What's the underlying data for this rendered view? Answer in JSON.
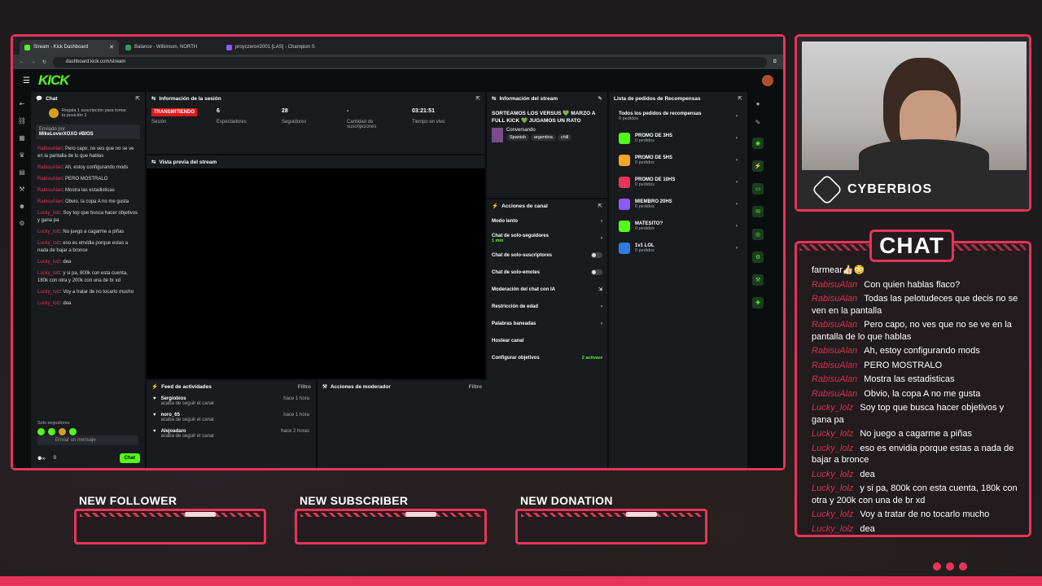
{
  "browser": {
    "tabs": [
      "Stream - Kick Dashboard",
      "Balance - Wilkinson, NORTH",
      "proyczero#2001 [LAS] - Champion S"
    ],
    "url": "dashboard.kick.com/stream"
  },
  "kick": {
    "logo": "KICK"
  },
  "dashboard": {
    "chat_panel": {
      "title": "Chat",
      "gift_text": "Regala 1 suscripción para tomar la posición 1",
      "pinned_label": "Enviado por",
      "pinned_text": "MikeLoverXOXO #BIOS",
      "messages": [
        {
          "user": "RabisuAlan",
          "text": "Pero capo, no ves que no se ve en la pantalla de lo que hablas"
        },
        {
          "user": "RabisuAlan",
          "text": "Ah, estoy configurando mods"
        },
        {
          "user": "RabisuAlan",
          "text": "PERO MOSTRALO"
        },
        {
          "user": "RabisuAlan",
          "text": "Mostra las estadisticas"
        },
        {
          "user": "RabisuAlan",
          "text": "Obvio, la copa A no me gusta"
        },
        {
          "user": "Lucky_lolz",
          "text": "Soy top que busca hacer objetivos y gana pa"
        },
        {
          "user": "Lucky_lolz",
          "text": "No juego a cagarme a piñas"
        },
        {
          "user": "Lucky_lolz",
          "text": "eso es envidia porque estas a nada de bajar a bronce"
        },
        {
          "user": "Lucky_lolz",
          "text": "dea"
        },
        {
          "user": "Lucky_lolz",
          "text": "y si pa, 800k con esta cuenta, 180k con otra y 200k con una de br xd"
        },
        {
          "user": "Lucky_lolz",
          "text": "Voy a tratar de no tocarlo mucho"
        },
        {
          "user": "Lucky_lolz",
          "text": "dea"
        }
      ],
      "followers_only": "Solo seguidores",
      "input_placeholder": "Enviar un mensaje",
      "count": "0",
      "send_label": "Chat"
    },
    "session": {
      "title": "Información de la sesión",
      "status": "TRANSMITIENDO",
      "status_label": "Sesión",
      "viewers": "6",
      "viewers_label": "Espectadores",
      "followers": "28",
      "followers_label": "Seguidores",
      "subs": "-",
      "subs_label": "Cantidad de suscripciones",
      "time": "03:21:51",
      "time_label": "Tiempo en vivo"
    },
    "preview_title": "Vista previa del stream",
    "feed": {
      "title": "Feed de actividades",
      "filter": "Filtro",
      "items": [
        {
          "name": "Sergiobios",
          "sub": "acaba de seguir el canal",
          "time": "hace 1 hora"
        },
        {
          "name": "noro_65",
          "sub": "acaba de seguir el canal",
          "time": "hace 1 hora"
        },
        {
          "name": "Alejoadaro",
          "sub": "acaba de seguir el canal",
          "time": "hace 2 horas"
        }
      ]
    },
    "mod_actions": {
      "title": "Acciones de moderador",
      "filter": "Filtro"
    },
    "stream_info": {
      "title": "Información del stream",
      "stream_title": "SORTEAMOS LOS VERSUS 💚 MARZO A FULL KICK 💚 JUGAMOS UN RATO",
      "category": "Conversando",
      "tags": [
        "Spanish",
        "argentina",
        "chill"
      ]
    },
    "channel_actions": {
      "title": "Acciones de canal",
      "items": [
        {
          "label": "Modo lento",
          "extra": ""
        },
        {
          "label": "Chat de solo-seguidores",
          "extra": "1 min"
        },
        {
          "label": "Chat de solo-suscriptores",
          "extra": ""
        },
        {
          "label": "Chat de solo-emotes",
          "extra": ""
        },
        {
          "label": "Moderación del chat con IA",
          "extra": ""
        },
        {
          "label": "Restricción de edad",
          "extra": ""
        },
        {
          "label": "Palabras baneadas",
          "extra": ""
        },
        {
          "label": "Hostear canal",
          "extra": ""
        },
        {
          "label": "Configurar objetivos",
          "extra": "2 activas"
        }
      ]
    },
    "rewards": {
      "title": "Lista de pedidos de Recompensas",
      "all_label": "Todos los pedidos de recompensas",
      "all_count": "0 pedidos",
      "items": [
        {
          "name": "PROMO DE 3HS",
          "count": "0 pedidos",
          "color": "#53fc18"
        },
        {
          "name": "PROMO DE 5HS",
          "count": "0 pedidos",
          "color": "#f5a623"
        },
        {
          "name": "PROMO DE 10HS",
          "count": "0 pedidos",
          "color": "#e8345a"
        },
        {
          "name": "MIEMBRO 20HS",
          "count": "0 pedidos",
          "color": "#8a5cf6"
        },
        {
          "name": "MATESITO?",
          "count": "0 pedidos",
          "color": "#53fc18"
        },
        {
          "name": "1v1 LOL",
          "count": "0 pedidos",
          "color": "#2f7de1"
        }
      ]
    }
  },
  "brand": {
    "name": "CYBERBIOS"
  },
  "overlay_chat": {
    "title": "CHAT",
    "first_line": "farmear👍🏻😳",
    "messages": [
      {
        "user": "RabisuAlan",
        "text": "Con quien hablas flaco?"
      },
      {
        "user": "RabisuAlan",
        "text": "Todas las pelotudeces que decis no se ven en la pantalla"
      },
      {
        "user": "RabisuAlan",
        "text": "Pero capo, no ves que no se ve en la pantalla de lo que hablas"
      },
      {
        "user": "RabisuAlan",
        "text": "Ah, estoy configurando mods"
      },
      {
        "user": "RabisuAlan",
        "text": "PERO MOSTRALO"
      },
      {
        "user": "RabisuAlan",
        "text": "Mostra las estadisticas"
      },
      {
        "user": "RabisuAlan",
        "text": "Obvio, la copa A no me gusta"
      },
      {
        "user": "Lucky_lolz",
        "text": "Soy top que busca hacer objetivos y gana pa"
      },
      {
        "user": "Lucky_lolz",
        "text": "No juego a cagarme a piñas"
      },
      {
        "user": "Lucky_lolz",
        "text": "eso es envidia porque estas a nada de bajar a bronce"
      },
      {
        "user": "Lucky_lolz",
        "text": "dea"
      },
      {
        "user": "Lucky_lolz",
        "text": "y si pa, 800k con esta cuenta, 180k con otra y 200k con una de br xd"
      },
      {
        "user": "Lucky_lolz",
        "text": "Voy a tratar de no tocarlo mucho"
      },
      {
        "user": "Lucky_lolz",
        "text": "dea"
      }
    ]
  },
  "alerts": [
    "NEW FOLLOWER",
    "NEW SUBSCRIBER",
    "NEW DONATION"
  ]
}
